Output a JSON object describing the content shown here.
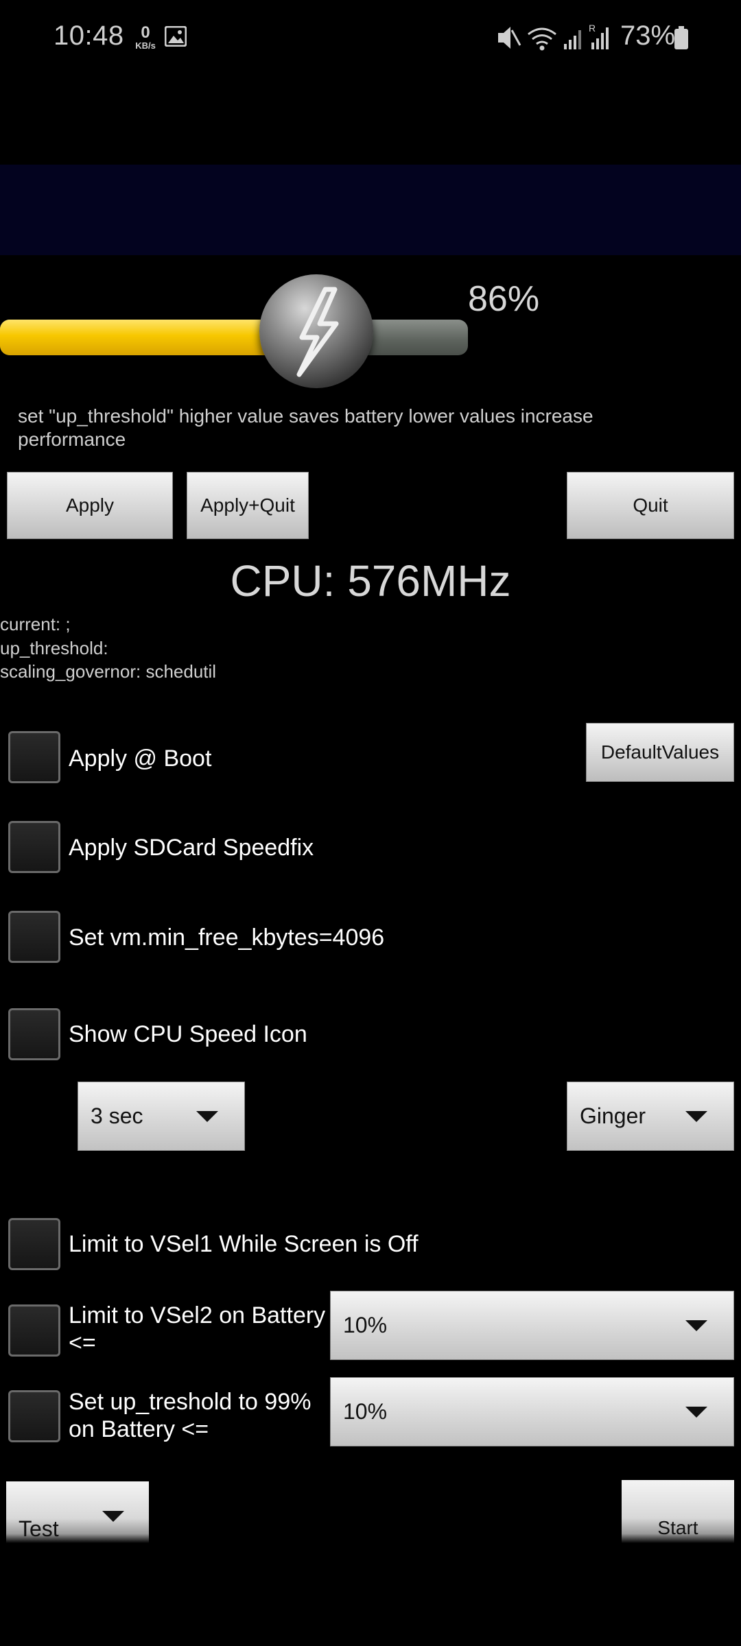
{
  "status_bar": {
    "time": "10:48",
    "net_speed": "0",
    "net_unit": "KB/s",
    "battery_pct": "73%",
    "icons": [
      "image-icon",
      "mute-icon",
      "wifi-icon",
      "signal-icon",
      "signal-r-icon",
      "battery-icon"
    ]
  },
  "slider": {
    "value_label": "86%",
    "value": 0.86
  },
  "description": "set \"up_threshold\" higher value saves battery lower values increase performance",
  "buttons": {
    "apply": "Apply",
    "apply_quit": "Apply+Quit",
    "quit": "Quit",
    "default_values": "DefaultValues"
  },
  "cpu": "CPU: 576MHz",
  "info": {
    "current": "current:  ;",
    "up_threshold": "up_threshold:",
    "scaling_governor": "scaling_governor:  schedutil"
  },
  "checks": {
    "apply_boot": "Apply @ Boot",
    "sdcard": "Apply SDCard Speedfix",
    "vm_min": "Set vm.min_free_kbytes=4096",
    "cpu_icon": "Show CPU Speed Icon",
    "vsel1": "Limit to VSel1 While Screen is Off",
    "vsel2": "Limit to VSel2 on Battery <=",
    "up_treshold": "Set up_treshold to 99% on Battery <="
  },
  "dropdowns": {
    "interval": "3 sec",
    "theme": "Ginger",
    "vsel2_pct": "10%",
    "up_pct": "10%",
    "test": "Test"
  },
  "start": "Start",
  "colors": {
    "slider_fill": "#f7c700",
    "ad_bar": "#03031f"
  }
}
